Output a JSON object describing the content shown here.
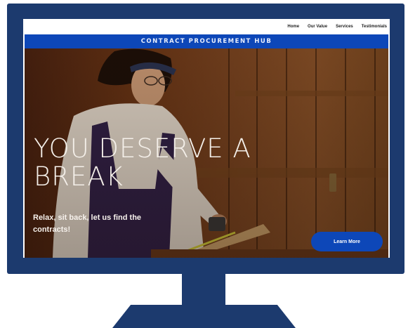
{
  "nav": {
    "items": [
      {
        "label": "Home"
      },
      {
        "label": "Our Value"
      },
      {
        "label": "Services"
      },
      {
        "label": "Testimonials"
      }
    ]
  },
  "banner": {
    "title": "CONTRACT PROCUREMENT HUB"
  },
  "hero": {
    "headline": "YOU DESERVE A BREAK",
    "subtext": "Relax, sit back, let us find the contracts!",
    "cta_label": "Learn More"
  },
  "colors": {
    "monitor": "#1c3a6e",
    "brand_blue": "#0d47b8",
    "wood": "#7a4420"
  },
  "icons": [
    "monitor-frame",
    "monitor-stand"
  ]
}
